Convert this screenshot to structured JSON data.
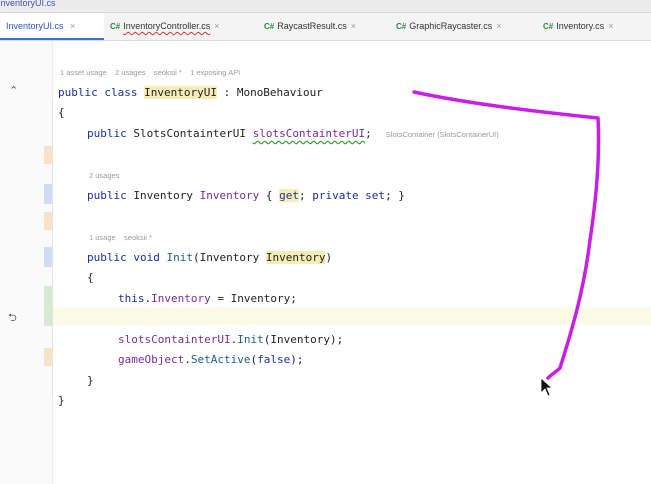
{
  "window": {
    "title": "InventoryUI.cs"
  },
  "tabs": [
    {
      "label": "InventoryUI.cs",
      "active": true,
      "cs": ""
    },
    {
      "label": "InventoryController.cs",
      "active": false,
      "cs": "C#"
    },
    {
      "label": "RaycastResult.cs",
      "active": false,
      "cs": "C#"
    },
    {
      "label": "GraphicRaycaster.cs",
      "active": false,
      "cs": "C#"
    },
    {
      "label": "Inventory.cs",
      "active": false,
      "cs": "C#"
    }
  ],
  "tab_close": "×",
  "code_hints": {
    "class": [
      "1 asset usage",
      "2 usages",
      "seoksii *",
      "1 exposing API"
    ],
    "property": "2 usages",
    "method": [
      "1 usage",
      "seoksii *"
    ],
    "field_inlay": "SlotsContainer (SlotsContainerUI)"
  },
  "code": {
    "l1": {
      "kw": "public class ",
      "name": "InventoryUI",
      "rest": " : MonoBehaviour"
    },
    "l2": "{",
    "l3": {
      "kw": "public ",
      "type": "SlotsContainterUI ",
      "name": "slotsContainterUI",
      "end": ";"
    },
    "l4": {
      "kw": "public ",
      "type": "Inventory ",
      "name": "Inventory",
      "open": " { ",
      "get": "get",
      "semi": "; ",
      "priv": "private set",
      "close": "; }"
    },
    "l5": {
      "kw": "public void ",
      "name": "Init",
      "open": "(Inventory ",
      "param": "Inventory",
      "close": ")"
    },
    "l6": "{",
    "l7": {
      "kw": "this",
      "dot": ".",
      "prop": "Inventory",
      "rest": " = Inventory;"
    },
    "l9": {
      "obj": "slotsContainterUI",
      "dot": ".",
      "meth": "Init",
      "rest": "(Inventory);"
    },
    "l10": {
      "obj": "gameObject",
      "dot": ".",
      "meth": "SetActive",
      "open": "(",
      "kw": "false",
      "close": ");"
    },
    "l11": "}",
    "l12": "}"
  },
  "gutter_icons": {
    "class": "⌃",
    "undo": "⮌"
  },
  "colors": {
    "annotation": "#c81ee6",
    "accent": "#2c4fd0",
    "keyword": "#1c2fa3",
    "property": "#7a2c9a"
  }
}
